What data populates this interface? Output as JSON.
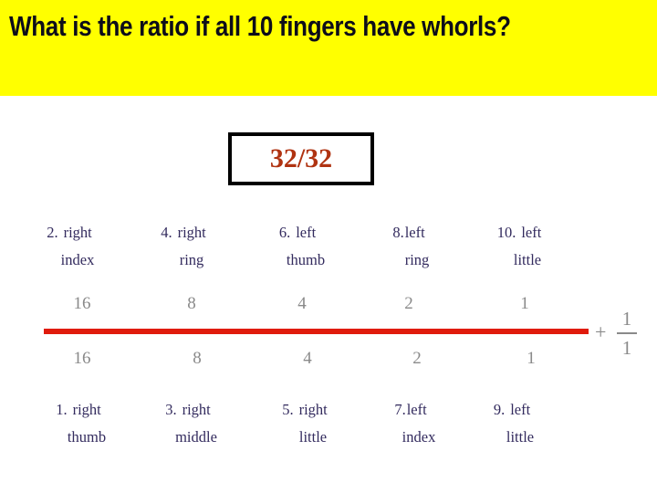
{
  "slide": {
    "title": "What is the ratio if all 10 fingers have whorls?",
    "background_color": "#ffffff",
    "banner_color": "#ffff00",
    "title_color": "#0d0d1a"
  },
  "ratio_box": {
    "value": "32/32",
    "text_color": "#b03311",
    "border_color": "#000000",
    "fill_color": "#ffffff"
  },
  "fraction": {
    "bar_color": "#e01b0c",
    "number_color": "#8a8a8a",
    "numerator": [
      "16",
      "8",
      "4",
      "2",
      "1"
    ],
    "denominator": [
      "16",
      "8",
      "4",
      "2",
      "1"
    ],
    "tail": {
      "operator": "+",
      "numerator": "1",
      "denominator": "1"
    }
  },
  "labels": {
    "color": "#332b5e",
    "top": [
      {
        "number": "2.",
        "line1": "right",
        "line2": "index"
      },
      {
        "number": "4.",
        "line1": "right",
        "line2": "ring"
      },
      {
        "number": "6.",
        "line1": "left",
        "line2": "thumb"
      },
      {
        "number": "8.",
        "line1": "left",
        "line2": "ring"
      },
      {
        "number": "10.",
        "line1": "left",
        "line2": "little"
      }
    ],
    "bottom": [
      {
        "number": "1.",
        "line1": "right",
        "line2": "thumb"
      },
      {
        "number": "3.",
        "line1": "right",
        "line2": "middle"
      },
      {
        "number": "5.",
        "line1": "right",
        "line2": "little"
      },
      {
        "number": "7.",
        "line1": "left",
        "line2": "index"
      },
      {
        "number": "9.",
        "line1": "left",
        "line2": "little"
      }
    ]
  },
  "chart_data": {
    "type": "table",
    "title": "What is the ratio if all 10 fingers have whorls?",
    "annotations": [
      "32/32"
    ],
    "categories": [
      "1. right thumb",
      "2. right index",
      "3. right middle",
      "4. right ring",
      "5. right little",
      "6. left thumb",
      "7. left index",
      "8. left ring",
      "9. left little",
      "10. left little"
    ],
    "series": [
      {
        "name": "numerator",
        "values": [
          16,
          8,
          4,
          2,
          1
        ]
      },
      {
        "name": "denominator",
        "values": [
          16,
          8,
          4,
          2,
          1
        ]
      },
      {
        "name": "tail",
        "values": [
          1,
          1
        ]
      }
    ]
  }
}
